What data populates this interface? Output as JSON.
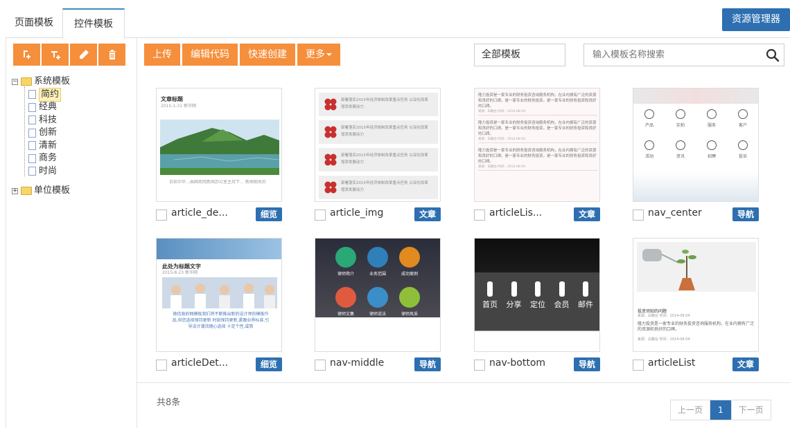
{
  "tabs": [
    {
      "label": "页面模板",
      "active": false
    },
    {
      "label": "控件模板",
      "active": true
    }
  ],
  "resource_button": "资源管理器",
  "left_tools": [
    "add-item-icon",
    "add-sub-icon",
    "pencil-icon",
    "trash-icon"
  ],
  "tree": {
    "root1": {
      "label": "系统模板",
      "children": [
        "简约",
        "经典",
        "科技",
        "创新",
        "清新",
        "商务",
        "时尚"
      ],
      "selected": "简约"
    },
    "root2": {
      "label": "单位模板"
    }
  },
  "toolbar": {
    "upload": "上传",
    "edit_code": "编辑代码",
    "quick_create": "快速创建",
    "more": "更多"
  },
  "filter": {
    "selected": "全部模板"
  },
  "search": {
    "placeholder": "输入模板名称搜索"
  },
  "cards": [
    {
      "name": "article_de...",
      "badge": "细览"
    },
    {
      "name": "article_img",
      "badge": "文章"
    },
    {
      "name": "articleLis...",
      "badge": "文章"
    },
    {
      "name": "nav_center",
      "badge": "导航"
    },
    {
      "name": "articleDet...",
      "badge": "细览"
    },
    {
      "name": "nav-middle",
      "badge": "导航"
    },
    {
      "name": "nav-bottom",
      "badge": "导航"
    },
    {
      "name": "articleList",
      "badge": "文章"
    }
  ],
  "thumbs": {
    "t1": {
      "title": "文章标题",
      "meta": "2015-1-31 新华网",
      "caption": "日前中华…由国务院新闻办公室主持下… 新闻相关的"
    },
    "t2": {
      "line1": "部署落实2015年经济体制改革重点任务 以深化改革",
      "line2": "增添发展动力"
    },
    "t3": {
      "line1": "隆力投资是一家专业的财务投资咨询服务机构，在业内拥有广泛的资源和良好的口碑。是一家专业的财务投资，是一家专业的财务投资和良好的口碑。",
      "meta": "来源：白癜台 时间：2014-08-04"
    },
    "t4": {
      "icons": [
        "产品",
        "实拍",
        "服务",
        "客户",
        "活动",
        "资讯",
        "招聘",
        "投诉"
      ]
    },
    "t5": {
      "title": "此处为标题文字",
      "meta": "2015-8-23 新华网",
      "body": "微信政府网模板我们将不断推出新的设计师的模板作品,供您选择保持更新 时刻保持更新,紧跟业界标准,引导设计潮流随心选择 十足个性,或简"
    },
    "t6": {
      "items": [
        "律师简介",
        "业务范围",
        "成功案例",
        "律师文集",
        "律师说法",
        "律师风采"
      ]
    },
    "t7": {
      "items": [
        "首页",
        "分享",
        "定位",
        "会员",
        "邮件"
      ]
    },
    "t8": {
      "title": "投资须知的问题",
      "meta": "来源：白癜台 时间：2014-08-04",
      "body": "隆力投资是一家专业的财务投资咨询服务机构，在业内拥有广泛的资源和良好的口碑。"
    }
  },
  "footer": {
    "total": "共8条",
    "prev": "上一页",
    "page": "1",
    "next": "下一页"
  },
  "colors": {
    "accent_orange": "#f58f3c",
    "accent_blue": "#2d6fb0"
  }
}
